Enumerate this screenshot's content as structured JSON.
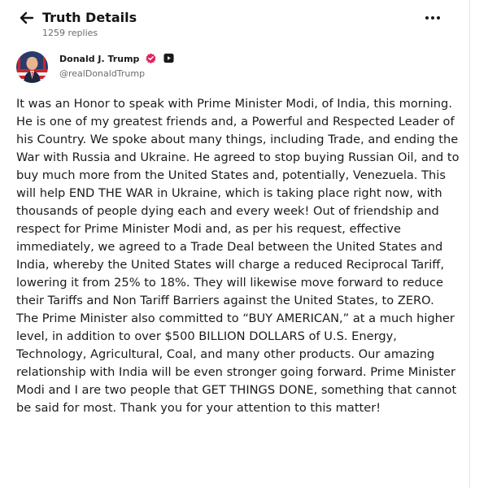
{
  "header": {
    "title": "Truth Details",
    "replies": "1259 replies",
    "back_icon": "arrow-left-icon",
    "more_icon": "more-horizontal-icon"
  },
  "author": {
    "name": "Donald J. Trump",
    "handle": "@realDonaldTrump",
    "verified_color": "#e0245e"
  },
  "post": {
    "text": "It was an Honor to speak with Prime Minister Modi, of India, this morning. He is one of my greatest friends and, a Powerful and Respected Leader of his Country. We spoke about many things, including Trade, and ending the War with Russia and Ukraine. He agreed to stop buying Russian Oil, and to buy much more from the United States and, potentially, Venezuela. This will help END THE WAR in Ukraine, which is taking place right now, with thousands of people dying each and every week! Out of friendship and respect for Prime Minister Modi and, as per his request, effective immediately, we agreed to a Trade Deal between the United States and India, whereby the United States will charge a reduced Reciprocal Tariff, lowering it from 25% to 18%. They will likewise move forward to reduce their Tariffs and Non Tariff Barriers against the United States, to ZERO. The Prime Minister also committed to “BUY AMERICAN,” at a much higher level, in addition to over $500 BILLION DOLLARS of U.S. Energy, Technology, Agricultural, Coal, and many other products. Our amazing relationship with India will be even stronger going forward. Prime Minister Modi and I are two people that GET THINGS DONE, something that cannot be said for most. Thank you for your attention to this matter!"
  }
}
